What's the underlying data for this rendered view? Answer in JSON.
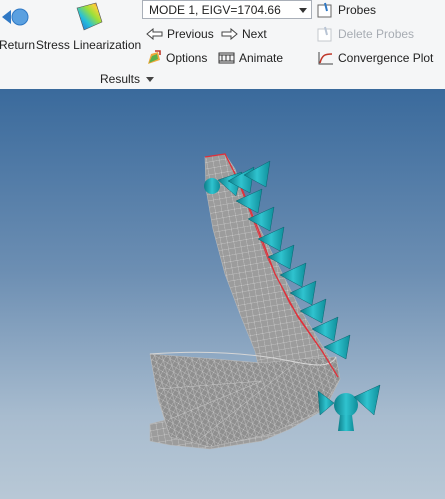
{
  "ribbon": {
    "return_label": "Return",
    "stress_label": "Stress Linearization",
    "mode_select": "MODE 1, EIGV=1704.66",
    "previous_label": "Previous",
    "next_label": "Next",
    "options_label": "Options",
    "animate_label": "Animate",
    "probes_label": "Probes",
    "delete_probes_label": "Delete Probes",
    "convergence_label": "Convergence Plot",
    "group_label": "Results"
  },
  "colors": {
    "ribbon_bg": "#f5f6f7",
    "viewport_top": "#3a6a9c",
    "viewport_bottom": "#b8c8d6",
    "mesh": "#9a9a9a",
    "constraint": "#1aa3b0",
    "edge_highlight": "#e0303a"
  },
  "icons": [
    "return-icon",
    "stress-linearization-icon",
    "previous-icon",
    "next-icon",
    "options-icon",
    "animate-icon",
    "probes-icon",
    "delete-probes-icon",
    "convergence-plot-icon",
    "dropdown-arrow-icon"
  ]
}
